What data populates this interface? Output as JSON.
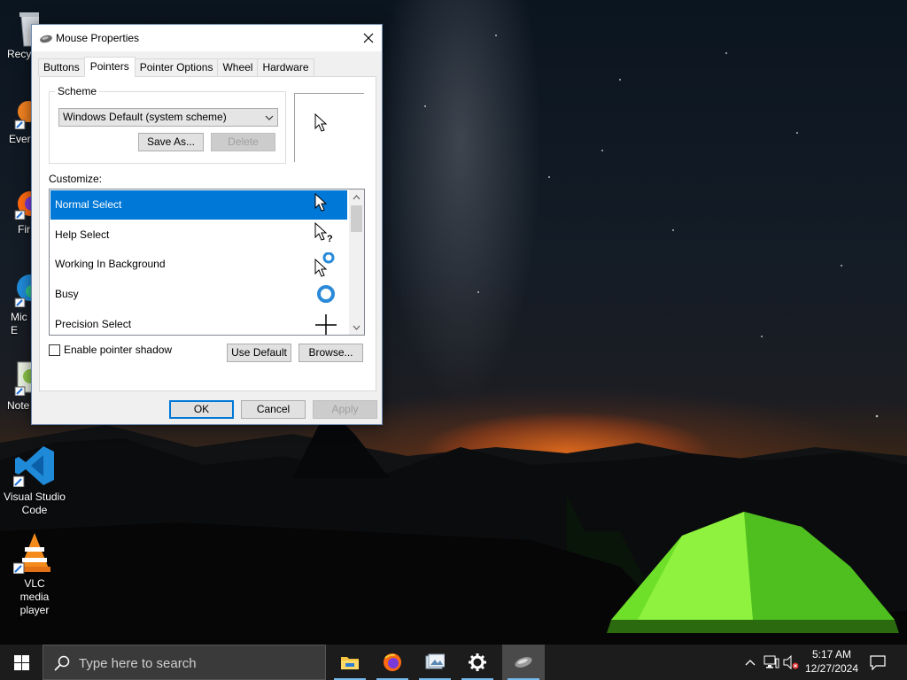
{
  "desktop": {
    "icons": [
      {
        "label": "Recy"
      },
      {
        "label": "Ever"
      },
      {
        "label": "Fir"
      },
      {
        "label": "Mic\nE"
      },
      {
        "label": "Note"
      },
      {
        "label": "Visual Studio Code"
      },
      {
        "label": "VLC media player"
      }
    ]
  },
  "dialog": {
    "title": "Mouse Properties",
    "tabs": [
      {
        "label": "Buttons"
      },
      {
        "label": "Pointers",
        "active": true
      },
      {
        "label": "Pointer Options"
      },
      {
        "label": "Wheel"
      },
      {
        "label": "Hardware"
      }
    ],
    "scheme": {
      "group_label": "Scheme",
      "selected": "Windows Default (system scheme)",
      "save_as_label": "Save As...",
      "delete_label": "Delete"
    },
    "customize_label": "Customize:",
    "pointers": [
      {
        "label": "Normal Select",
        "icon": "arrow-cursor-icon",
        "selected": true
      },
      {
        "label": "Help Select",
        "icon": "help-cursor-icon"
      },
      {
        "label": "Working In Background",
        "icon": "working-cursor-icon"
      },
      {
        "label": "Busy",
        "icon": "busy-cursor-icon"
      },
      {
        "label": "Precision Select",
        "icon": "crosshair-cursor-icon"
      }
    ],
    "shadow_label": "Enable pointer shadow",
    "shadow_checked": false,
    "use_default_label": "Use Default",
    "browse_label": "Browse...",
    "ok_label": "OK",
    "cancel_label": "Cancel",
    "apply_label": "Apply"
  },
  "taskbar": {
    "search_placeholder": "Type here to search",
    "apps": [
      {
        "icon": "file-explorer-icon"
      },
      {
        "icon": "firefox-icon"
      },
      {
        "icon": "photos-icon"
      },
      {
        "icon": "settings-gear-icon"
      },
      {
        "icon": "mouse-properties-icon",
        "active": true
      }
    ],
    "time": "5:17 AM",
    "date": "12/27/2024"
  },
  "colors": {
    "accent": "#0078d7",
    "taskbar": "#1c1c1c"
  }
}
